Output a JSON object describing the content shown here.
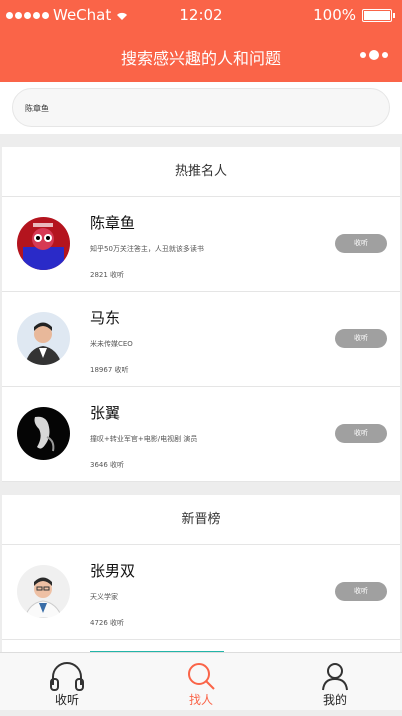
{
  "status": {
    "carrier": "WeChat",
    "time": "12:02",
    "battery": "100%"
  },
  "nav": {
    "title": "搜索感兴趣的人和问题"
  },
  "search": {
    "value": "陈章鱼"
  },
  "sections": {
    "hot": {
      "title": "热推名人",
      "people": [
        {
          "name": "陈章鱼",
          "desc": "知乎50万关注答主，人丑就该多读书",
          "count": "2821 收听",
          "action": "收听"
        },
        {
          "name": "马东",
          "desc": "米未传媒CEO",
          "count": "18967 收听",
          "action": "收听"
        },
        {
          "name": "张翼",
          "desc": "撞叹+转业军官+电影/电视剧 演员",
          "count": "3646 收听",
          "action": "收听"
        }
      ]
    },
    "new": {
      "title": "新晋榜",
      "people": [
        {
          "name": "张男双",
          "desc": "天义学家",
          "count": "4726 收听",
          "action": "收听"
        }
      ]
    }
  },
  "tabs": [
    {
      "label": "收听",
      "icon": "headphones-icon"
    },
    {
      "label": "找人",
      "icon": "search-icon"
    },
    {
      "label": "我的",
      "icon": "user-icon"
    }
  ],
  "colors": {
    "accent": "#fa6448",
    "button": "#a0a0a0",
    "divider": "#22b5a8"
  }
}
